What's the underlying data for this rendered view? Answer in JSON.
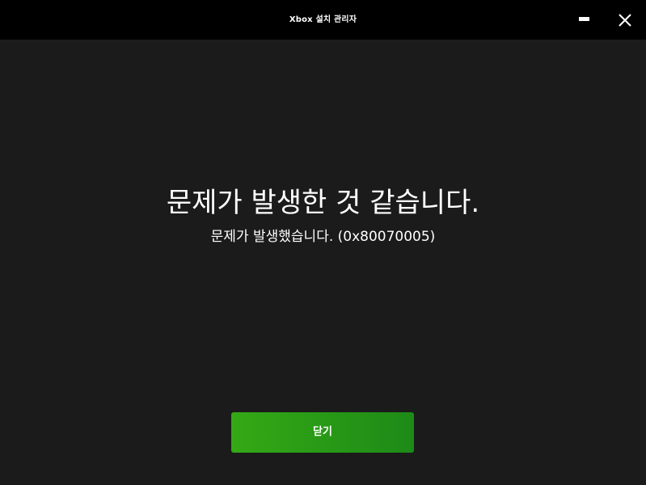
{
  "window": {
    "title": "Xbox 설치 관리자",
    "controls": {
      "minimize_icon": "minimize-icon",
      "close_icon": "close-icon"
    }
  },
  "main": {
    "heading": "문제가 발생한 것 같습니다.",
    "message": "문제가 발생했습니다. (0x80070005)",
    "close_button_label": "닫기"
  },
  "colors": {
    "titlebar": "#000000",
    "background": "#1b1b1b",
    "button_gradient_start": "#34a915",
    "button_gradient_end": "#1d8a17",
    "text": "#ffffff"
  }
}
